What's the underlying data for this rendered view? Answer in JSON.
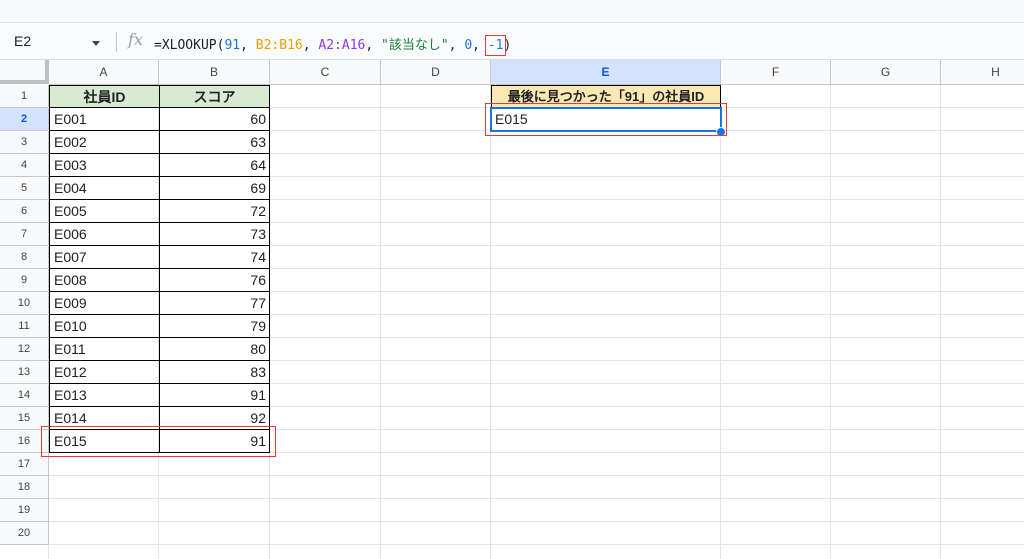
{
  "formula_bar": {
    "name_box": "E2",
    "fx_label": "fx",
    "formula": {
      "prefix": "=XLOOKUP(",
      "lookup": "91",
      "c1": ", ",
      "range1": "B2:B16",
      "c2": ", ",
      "range2": "A2:A16",
      "c3": ", ",
      "not_found": "\"該当なし\"",
      "c4": ", ",
      "match_mode": "0",
      "c5": ", ",
      "search_mode": "-1",
      "suffix": ")"
    }
  },
  "columns": [
    "A",
    "B",
    "C",
    "D",
    "E",
    "F",
    "G",
    "H"
  ],
  "row_numbers": [
    "1",
    "2",
    "3",
    "4",
    "5",
    "6",
    "7",
    "8",
    "9",
    "10",
    "11",
    "12",
    "13",
    "14",
    "15",
    "16",
    "17",
    "18",
    "19",
    "20"
  ],
  "table": {
    "header_id": "社員ID",
    "header_score": "スコア",
    "rows": [
      {
        "id": "E001",
        "score": "60"
      },
      {
        "id": "E002",
        "score": "63"
      },
      {
        "id": "E003",
        "score": "64"
      },
      {
        "id": "E004",
        "score": "69"
      },
      {
        "id": "E005",
        "score": "72"
      },
      {
        "id": "E006",
        "score": "73"
      },
      {
        "id": "E007",
        "score": "74"
      },
      {
        "id": "E008",
        "score": "76"
      },
      {
        "id": "E009",
        "score": "77"
      },
      {
        "id": "E010",
        "score": "79"
      },
      {
        "id": "E011",
        "score": "80"
      },
      {
        "id": "E012",
        "score": "83"
      },
      {
        "id": "E013",
        "score": "91"
      },
      {
        "id": "E014",
        "score": "92"
      },
      {
        "id": "E015",
        "score": "91"
      }
    ]
  },
  "result": {
    "header": "最後に見つかった「91」の社員ID",
    "value": "E015"
  },
  "colors": {
    "green_header": "#d9ead3",
    "yellow_header": "#fce8b2",
    "highlight_red": "#e53935",
    "selection_blue": "#1a73e8"
  }
}
